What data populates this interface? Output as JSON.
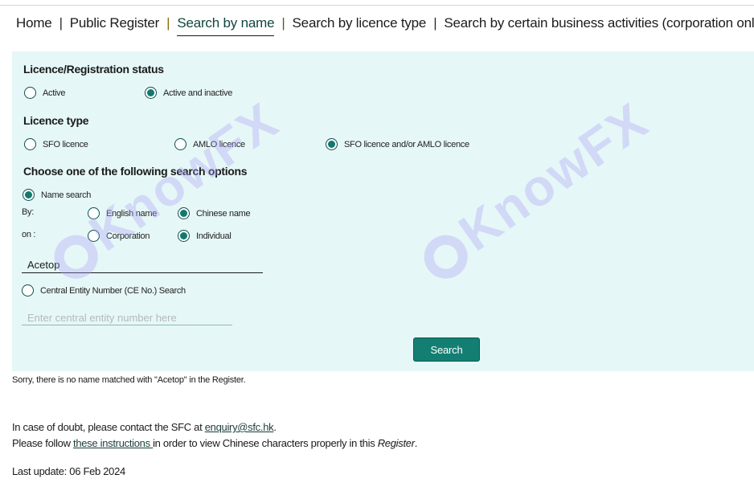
{
  "nav": {
    "items": [
      {
        "label": "Home",
        "active": false
      },
      {
        "label": "Public Register",
        "active": false
      },
      {
        "label": "Search by name",
        "active": true
      },
      {
        "label": "Search by licence type",
        "active": false
      },
      {
        "label": "Search by certain business activities (corporation only)",
        "active": false
      }
    ],
    "separator": "|"
  },
  "form": {
    "status": {
      "title": "Licence/Registration status",
      "options": [
        {
          "label": "Active",
          "checked": false
        },
        {
          "label": "Active and inactive",
          "checked": true
        }
      ]
    },
    "licence_type": {
      "title": "Licence type",
      "options": [
        {
          "label": "SFO licence",
          "checked": false
        },
        {
          "label": "AMLO licence",
          "checked": false
        },
        {
          "label": "SFO licence and/or AMLO licence",
          "checked": true
        }
      ]
    },
    "search_options": {
      "title": "Choose one of the following search options",
      "name_search": {
        "label": "Name search",
        "checked": true
      },
      "by": {
        "label": "By:",
        "options": [
          {
            "label": "English name",
            "checked": false
          },
          {
            "label": "Chinese name",
            "checked": true
          }
        ]
      },
      "on": {
        "label": "on :",
        "options": [
          {
            "label": "Corporation",
            "checked": false
          },
          {
            "label": "Individual",
            "checked": true
          }
        ]
      },
      "name_input_value": "Acetop",
      "ce_search": {
        "label": "Central Entity Number (CE No.) Search",
        "checked": false
      },
      "ce_input_value": "",
      "ce_input_placeholder": "Enter central entity number here"
    },
    "search_button": "Search"
  },
  "result_message": "Sorry, there is no name matched with \"Acetop\" in the Register.",
  "footer": {
    "doubt_prefix": "In case of doubt, please contact the SFC at ",
    "email": "enquiry@sfc.hk",
    "doubt_suffix": ".",
    "instructions_prefix": "Please follow ",
    "instructions_link": "these instructions ",
    "instructions_middle": "in order to view Chinese characters properly in this ",
    "instructions_italic": "Register",
    "instructions_suffix": ".",
    "last_update": "Last update: 06 Feb 2024"
  },
  "watermark": {
    "text": "KnowFX"
  },
  "colors": {
    "accent": "#137f72",
    "panel_bg": "#e6f7f7",
    "radio_border": "#0e4f49"
  }
}
